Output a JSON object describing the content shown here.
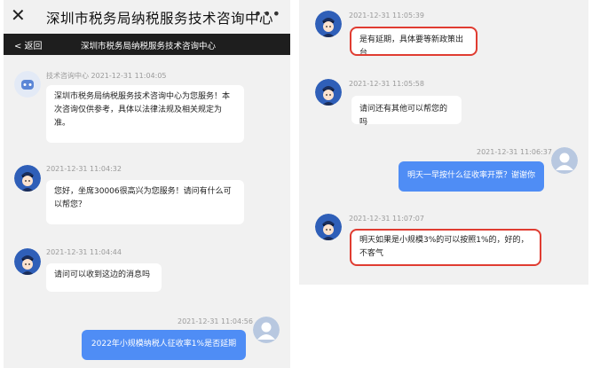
{
  "header": {
    "title": "深圳市税务局纳税服务技术咨询中心",
    "close_icon": "close-icon",
    "more_icon": "more-icon",
    "back_label": "< 返回",
    "subtitle": "深圳市税务局纳税服务技术咨询中心"
  },
  "left_chat": [
    {
      "sender": "技术咨询中心",
      "time": "技术咨询中心 2021-12-31 11:04:05",
      "text": "深圳市税务局纳税服务技术咨询中心为您服务！本次咨询仅供参考，具体以法律法规及相关规定为准。"
    },
    {
      "time": "2021-12-31 11:04:32",
      "text": "您好，坐席30006很高兴为您服务！请问有什么可以帮您？"
    },
    {
      "time": "2021-12-31 11:04:44",
      "text": "请问可以收到这边的消息吗"
    },
    {
      "time": "2021-12-31 11:04:56",
      "text": "2022年小规模纳税人征收率1%是否延期"
    }
  ],
  "right_chat": [
    {
      "time": "2021-12-31 11:05:39",
      "text": "是有延期，具体要等新政策出台"
    },
    {
      "time": "2021-12-31 11:05:58",
      "text": "请问还有其他可以帮您的吗"
    },
    {
      "time": "2021-12-31 11:06:37",
      "text": "明天一早按什么征收率开票？谢谢你"
    },
    {
      "time": "2021-12-31 11:07:07",
      "text": "明天如果是小规模3%的可以按照1%的，好的，不客气"
    }
  ],
  "colors": {
    "user_bubble": "#4f8df5",
    "highlight": "#e03c31",
    "topbar_dark": "#1e1e1e"
  }
}
